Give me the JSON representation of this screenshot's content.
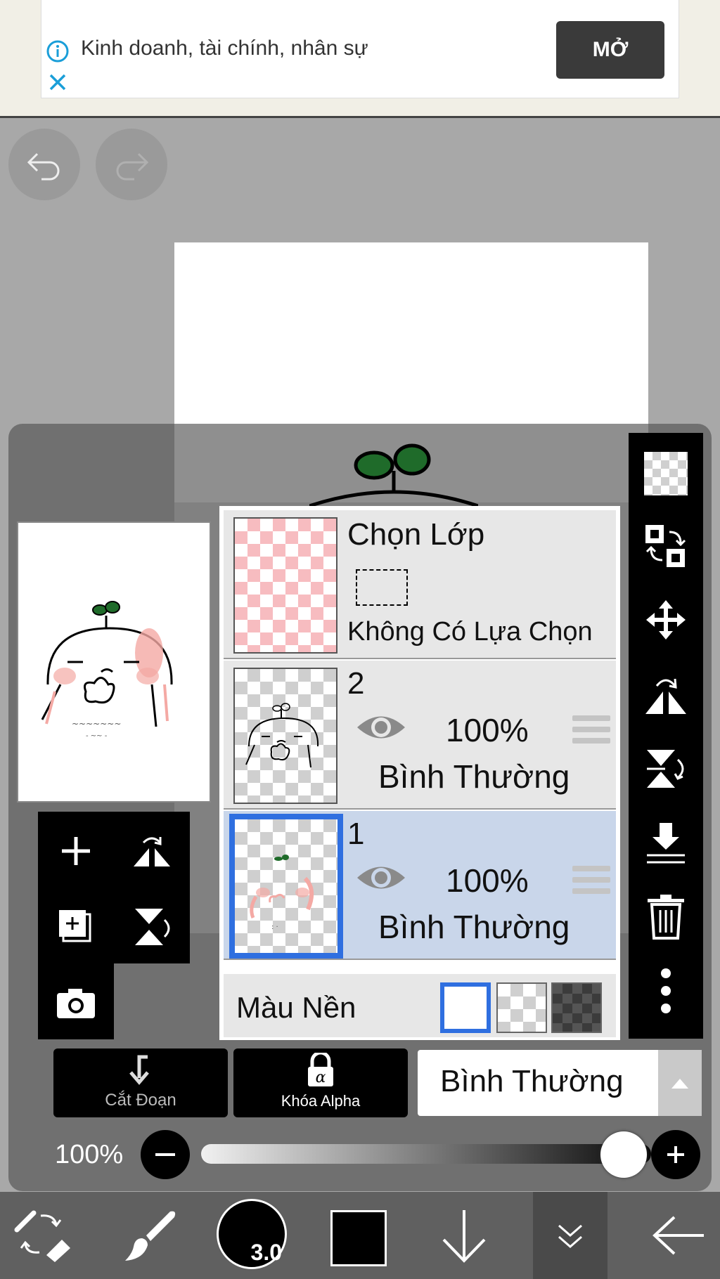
{
  "ad": {
    "text": "Kinh doanh, tài chính, nhân sự",
    "open_label": "MỞ",
    "info_icon": "info-icon",
    "close_icon": "close-icon"
  },
  "toolbar_top": {
    "undo_icon": "undo-icon",
    "redo_icon": "redo-icon"
  },
  "layers": [
    {
      "name": "Chọn Lớp",
      "subtitle": "Không Có Lựa Chọn",
      "type": "selection"
    },
    {
      "name": "2",
      "opacity": "100%",
      "blend": "Bình Thường",
      "visible": true,
      "selected": false
    },
    {
      "name": "1",
      "opacity": "100%",
      "blend": "Bình Thường",
      "visible": true,
      "selected": true
    }
  ],
  "background": {
    "label": "Màu Nền",
    "options": [
      "white",
      "transparent",
      "dark"
    ],
    "selected": "white"
  },
  "right_tools": [
    "transparency-icon",
    "transform-layer-icon",
    "move-icon",
    "flip-horizontal-icon",
    "flip-vertical-icon",
    "merge-down-icon",
    "delete-icon",
    "more-icon"
  ],
  "left_tools": [
    "add-layer-icon",
    "flip-layer-icon",
    "add-copy-icon",
    "flip-rotate-icon",
    "camera-icon"
  ],
  "modes": {
    "clip_label": "Cắt Đoạn",
    "alpha_label": "Khóa Alpha",
    "blend_value": "Bình Thường"
  },
  "opacity": {
    "label": "100%",
    "value": 1.0
  },
  "bottom": {
    "brush_size": "3.0",
    "color": "#000000"
  },
  "colors": {
    "accent": "#2f6fe0",
    "selected_row": "#c9d6ea",
    "sprout": "#1f6b2a",
    "blush": "#f4a9a4"
  }
}
